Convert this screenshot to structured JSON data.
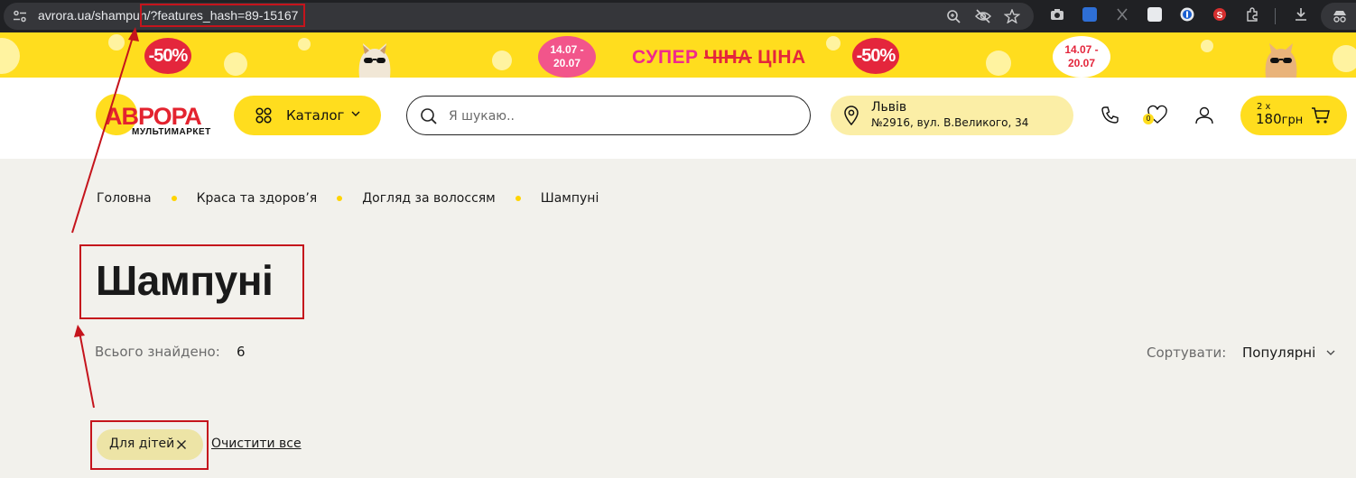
{
  "browser": {
    "url_host_path": "avrora.ua/shampun",
    "url_query": "/?features_hash=89-15167",
    "icons": [
      "site-settings-icon",
      "zoom-icon",
      "eye-off-icon",
      "star-icon",
      "camera-icon",
      "extensions-icon",
      "download-icon"
    ]
  },
  "banner": {
    "sale_left": "-50%",
    "date_left": "14.07 -",
    "date_left_2": "20.07",
    "promo_word_1": "СУПЕР",
    "promo_word_2": "ЧІНА",
    "promo_word_3": "ЦІНА",
    "sale_right": "-50%",
    "date_right": "14.07 -",
    "date_right_2": "20.07",
    "colors": {
      "background": "#ffdd1e",
      "red": "#e4263c",
      "pink": "#f2558b"
    }
  },
  "header": {
    "logo_word": "АВРОРА",
    "logo_sub": "МУЛЬТИМАРКЕТ",
    "catalog_label": "Каталог",
    "search_placeholder": "Я шукаю..",
    "location_city": "Львів",
    "location_address": "№2916, вул. В.Великого, 34",
    "favorites_count": "0",
    "cart_qty": "2 x",
    "cart_price": "180",
    "cart_currency": "грн",
    "accent_color": "#ffdd1e"
  },
  "breadcrumb": [
    "Головна",
    "Краса та здоров’я",
    "Догляд за волоссям",
    "Шампуні"
  ],
  "page": {
    "title": "Шампуні",
    "found_label": "Всього знайдено:",
    "found_count": "6",
    "sort_label": "Сортувати:",
    "sort_value": "Популярні",
    "filter_chip": "Для дітей",
    "clear_all": "Очистити все"
  }
}
